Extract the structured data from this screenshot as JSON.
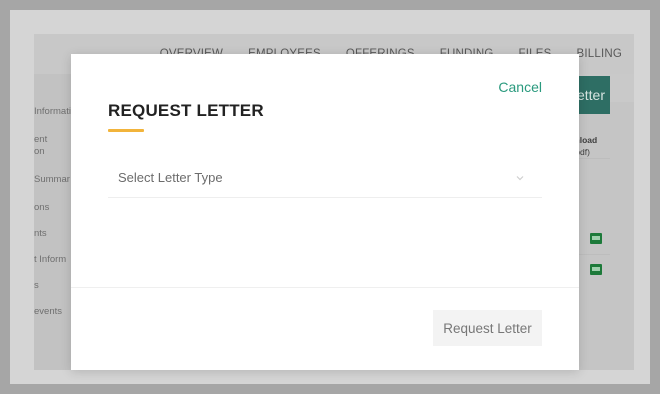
{
  "nav": {
    "items": [
      "OVERVIEW",
      "EMPLOYEES",
      "OFFERINGS",
      "FUNDING",
      "FILES",
      "BILLING"
    ]
  },
  "sidebar": {
    "items": [
      "Informati",
      "ent",
      "on",
      "Summar",
      "ons",
      "nts",
      "t Inform",
      "s",
      "events"
    ]
  },
  "background": {
    "letter_button_label": "st Letter",
    "column_header_line1": "ownload",
    "column_header_line2": "(.pdf)",
    "file_icon": "pdf-file-icon"
  },
  "modal": {
    "title": "REQUEST LETTER",
    "cancel_label": "Cancel",
    "select_placeholder": "Select Letter Type",
    "submit_label": "Request Letter",
    "accent_color": "#f2b43b",
    "link_color": "#2a9a7e"
  }
}
